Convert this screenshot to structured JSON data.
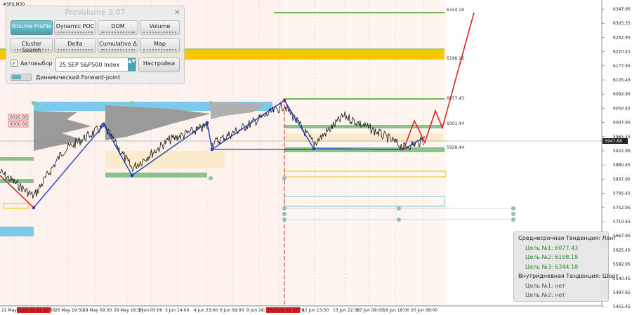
{
  "chart_header": "#SPX,M30",
  "price_axis": [
    "6347.95",
    "6305.35",
    "6262.95",
    "6220.45",
    "6177.95",
    "6135.45",
    "6092.95",
    "6050.45",
    "6007.95",
    "5965.45",
    "5922.95",
    "5880.45",
    "5837.95",
    "5795.45",
    "5752.95",
    "5710.45",
    "5667.95",
    "5625.45",
    "5582.95",
    "5540.45",
    "5497.95",
    "5455.45"
  ],
  "current_price": "5947.68",
  "time_axis": [
    "22 May 2025",
    "2025.05.23 15:30",
    "26 May 19:30",
    "28 May 09:30",
    "29 May 18:30",
    "2 Jun 05:00",
    "3 Jun 14:00",
    "4 Jun 23:00",
    "6 Jun 09:00",
    "9 Jun 18:30",
    "2025.06.11 15:30",
    "12 Jun 13:30",
    "13 Jun 22:30",
    "17 Jun 09:00",
    "18 Jun 18:00",
    "20 Jun 08:00"
  ],
  "level_tags": {
    "t6344": "6344.18",
    "t6198": "6198.18",
    "t6077": "6077.43",
    "t6001": "6001.44",
    "t5928": "5928.44",
    "red1": "6020.00",
    "red2": "6000.00"
  },
  "colors": {
    "up_line": "#1f3fbf",
    "forecast": "#dd2222",
    "cloud": "#7ec8e8",
    "green_zone": "#8fbf8f",
    "yellow_zone": "#f6c800"
  },
  "panel": {
    "title": "ProVolume 2.07",
    "close": "✕",
    "buttons": {
      "volume_profile": "Volume Profile",
      "dynamic_poc": "Dynamic POC",
      "dom": "DOM",
      "volume": "Volume",
      "cluster_search": "Cluster Search",
      "delta": "Delta",
      "cumulative_delta": "Cumulative Δ",
      "map": "Map"
    },
    "auto_check": "✓",
    "auto_label": "Автовыбор",
    "instrument": "25.SEP S&P500 Index",
    "instrument_arrow": "▲▼",
    "settings": "Настройки",
    "forward_label": "Динамический Forward-point"
  },
  "trend": {
    "mid_title": "Среднесрочная Тенденция: Лонг",
    "mid_targets": [
      {
        "label": "Цель №1:",
        "value": "6077.43"
      },
      {
        "label": "Цель №2:",
        "value": "6198.18"
      },
      {
        "label": "Цель №3:",
        "value": "6344.18"
      }
    ],
    "intra_title": "Внутридневная Тенденция: Шорт",
    "intra_targets": [
      {
        "label": "Цель №1:",
        "value": "нет"
      },
      {
        "label": "Цель №2:",
        "value": "нет"
      }
    ]
  }
}
